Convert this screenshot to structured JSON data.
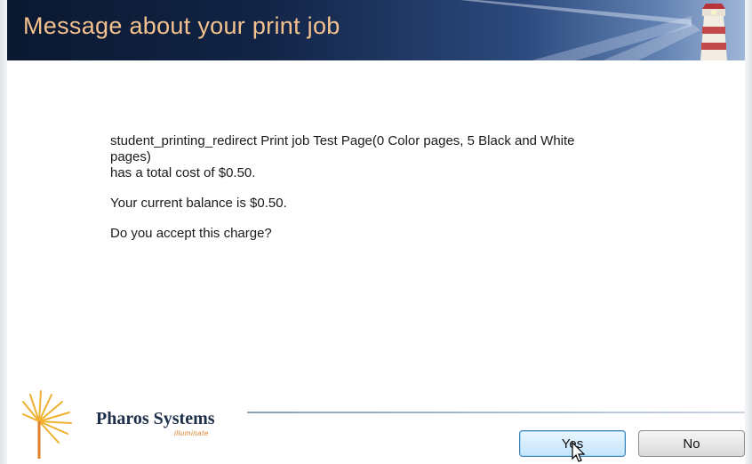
{
  "window": {
    "title": "Message about your print job"
  },
  "message": {
    "line1": "student_printing_redirect Print job Test Page(0 Color pages, 5 Black and White",
    "line2": "pages)",
    "line3": "has a total cost of $0.50.",
    "balance": "Your current balance is $0.50.",
    "question": "Do you accept this charge?"
  },
  "brand": {
    "name": "Pharos Systems",
    "tagline": "illuminate",
    "logo_icon": "sunburst-logo",
    "accent_color": "#e0802a"
  },
  "buttons": {
    "yes_label": "Yes",
    "no_label": "No"
  },
  "colors": {
    "header_dark": "#0a1830",
    "title_text": "#f3c28e"
  }
}
